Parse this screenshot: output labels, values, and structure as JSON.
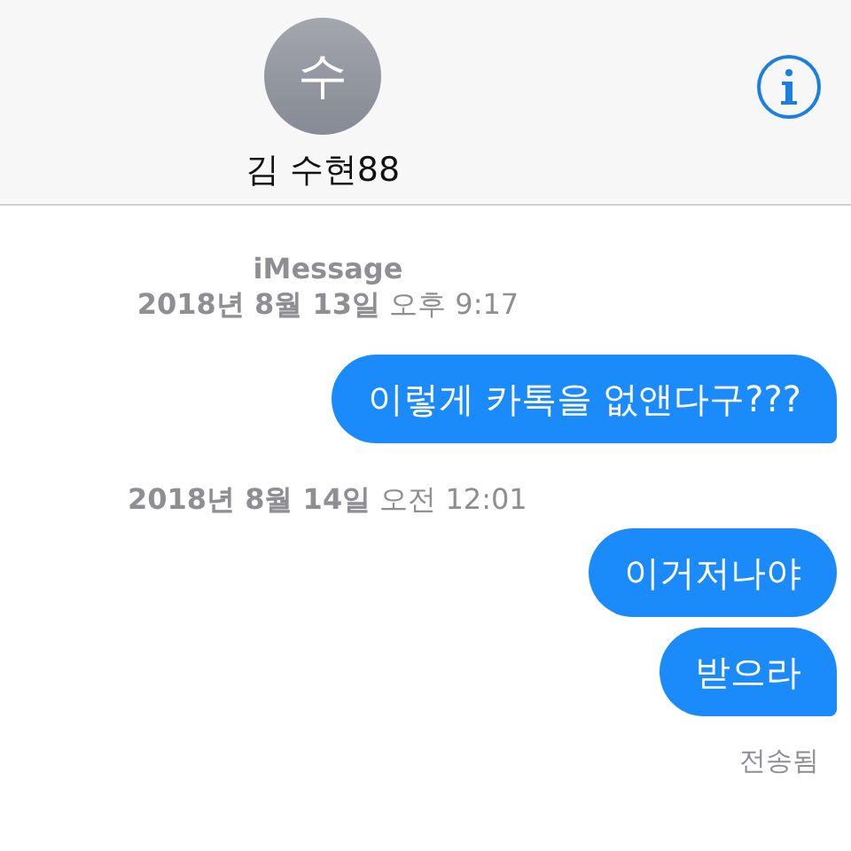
{
  "header": {
    "avatar_initial": "수",
    "contact_name": "김 수현88"
  },
  "conversation": [
    {
      "kind": "service",
      "text": "iMessage"
    },
    {
      "kind": "timestamp",
      "text": "**2018년 8월 13일** 오후 9:17"
    },
    {
      "kind": "message",
      "text": "이렇게 카톡을 없앤다구???",
      "tail": true
    },
    {
      "kind": "timestamp",
      "text": "**2018년 8월 14일** 오전 12:01"
    },
    {
      "kind": "message",
      "text": "이거저나야",
      "tail": false
    },
    {
      "kind": "message",
      "text": "받으라",
      "tail": true
    },
    {
      "kind": "status",
      "text": "전송됨"
    }
  ]
}
